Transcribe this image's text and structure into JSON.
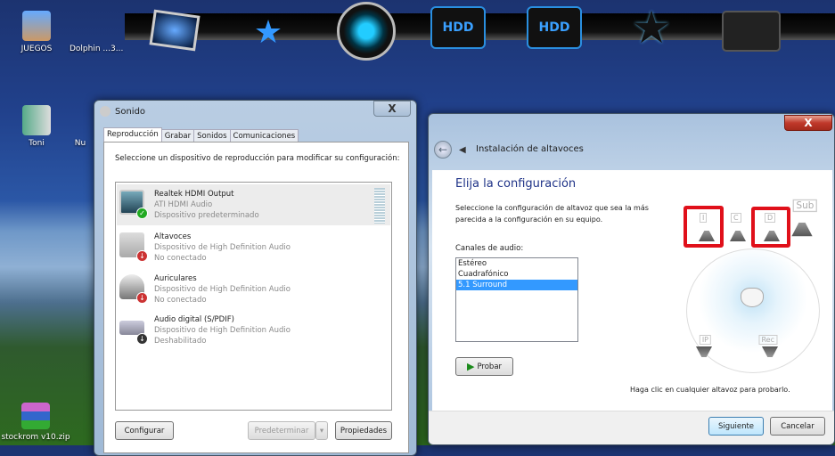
{
  "desktop": {
    "icons": [
      {
        "label": "JUEGOS"
      },
      {
        "label": "Dolphin ...3..."
      },
      {
        "label": "Toni"
      },
      {
        "label": "Nu"
      },
      {
        "label": "stockrom v10.zip"
      }
    ],
    "dock": [
      {
        "icon": "monitor-icon"
      },
      {
        "icon": "drive-star-icon"
      },
      {
        "icon": "orb-icon"
      },
      {
        "label": "HDD"
      },
      {
        "label": "HDD"
      },
      {
        "icon": "star-icon"
      },
      {
        "icon": "mixer-icon"
      }
    ]
  },
  "sound_window": {
    "title": "Sonido",
    "close": "X",
    "tabs": [
      {
        "label": "Reproducción",
        "active": true
      },
      {
        "label": "Grabar"
      },
      {
        "label": "Sonidos"
      },
      {
        "label": "Comunicaciones"
      }
    ],
    "description": "Seleccione un dispositivo de reproducción para modificar su configuración:",
    "devices": [
      {
        "name": "Realtek HDMI Output",
        "driver": "ATI HDMI Audio",
        "status": "Dispositivo predeterminado",
        "badge": "✓",
        "selected": true
      },
      {
        "name": "Altavoces",
        "driver": "Dispositivo de High Definition Audio",
        "status": "No conectado",
        "badge": "↓"
      },
      {
        "name": "Auriculares",
        "driver": "Dispositivo de High Definition Audio",
        "status": "No conectado",
        "badge": "↓"
      },
      {
        "name": "Audio digital (S/PDIF)",
        "driver": "Dispositivo de High Definition Audio",
        "status": "Deshabilitado",
        "badge": "↓"
      }
    ],
    "buttons": {
      "configure": "Configurar",
      "set_default": "Predeterminar",
      "dropdown": "▾",
      "properties": "Propiedades"
    }
  },
  "speaker_window": {
    "title": "Instalación de altavoces",
    "close": "X",
    "back": "←",
    "heading": "Elija la configuración",
    "description_line1": "Seleccione la configuración de altavoz que sea la más",
    "description_line2": "parecida a la configuración en su equipo.",
    "channels_label": "Canales de audio:",
    "channels": [
      "Estéreo",
      "Cuadrafónico",
      "5.1 Surround"
    ],
    "selected_channel": "5.1 Surround",
    "test_button": "Probar",
    "speakers": {
      "left": "I",
      "center": "C",
      "right": "D",
      "sub": "Sub",
      "rear_left": "IP",
      "rear_right": "Rec"
    },
    "hint": "Haga clic en cualquier altavoz para probarlo.",
    "next": "Siguiente",
    "cancel": "Cancelar"
  }
}
